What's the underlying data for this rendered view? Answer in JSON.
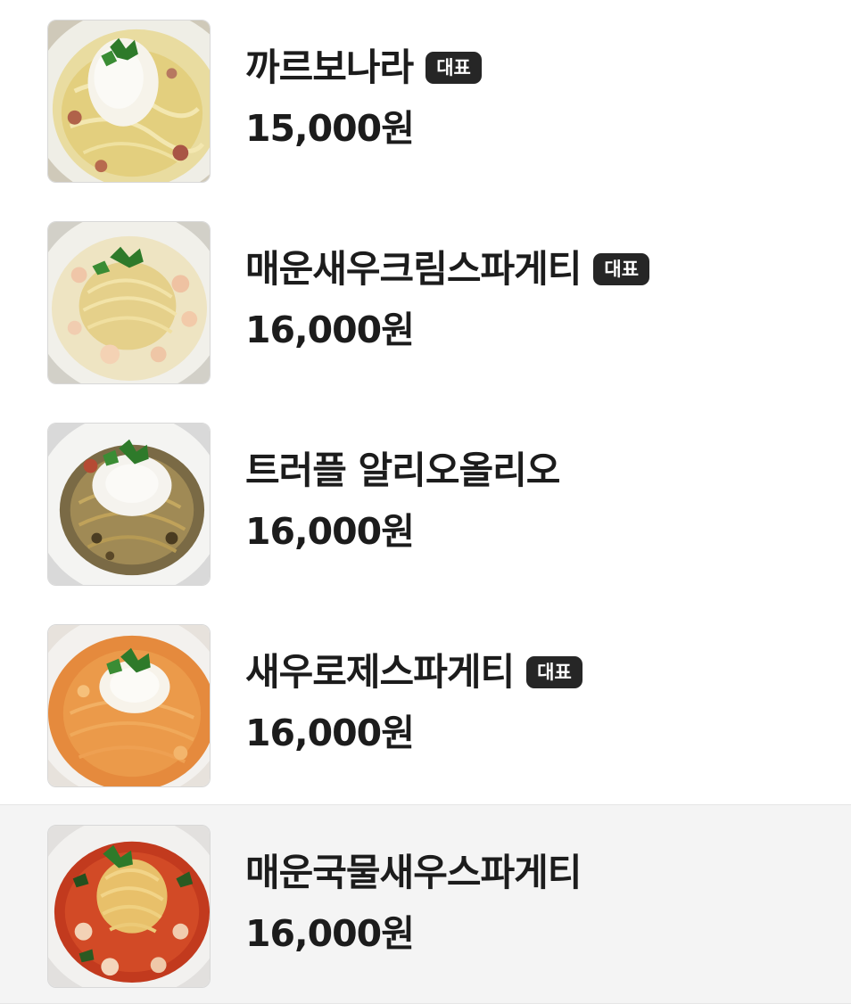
{
  "menu": {
    "items": [
      {
        "name": "까르보나라",
        "badge": "대표",
        "price": "15,000원",
        "image_icon": "carbonara-photo"
      },
      {
        "name": "매운새우크림스파게티",
        "badge": "대표",
        "price": "16,000원",
        "image_icon": "spicy-shrimp-cream-spaghetti-photo"
      },
      {
        "name": "트러플 알리오올리오",
        "badge": "",
        "price": "16,000원",
        "image_icon": "truffle-aglio-olio-photo"
      },
      {
        "name": "새우로제스파게티",
        "badge": "대표",
        "price": "16,000원",
        "image_icon": "shrimp-rose-spaghetti-photo"
      },
      {
        "name": "매운국물새우스파게티",
        "badge": "",
        "price": "16,000원",
        "image_icon": "spicy-broth-shrimp-spaghetti-photo"
      }
    ]
  },
  "colors": {
    "badge_background": "#262626",
    "badge_text": "#ffffff",
    "highlight_background": "#f4f4f4",
    "text": "#1c1c1c"
  }
}
